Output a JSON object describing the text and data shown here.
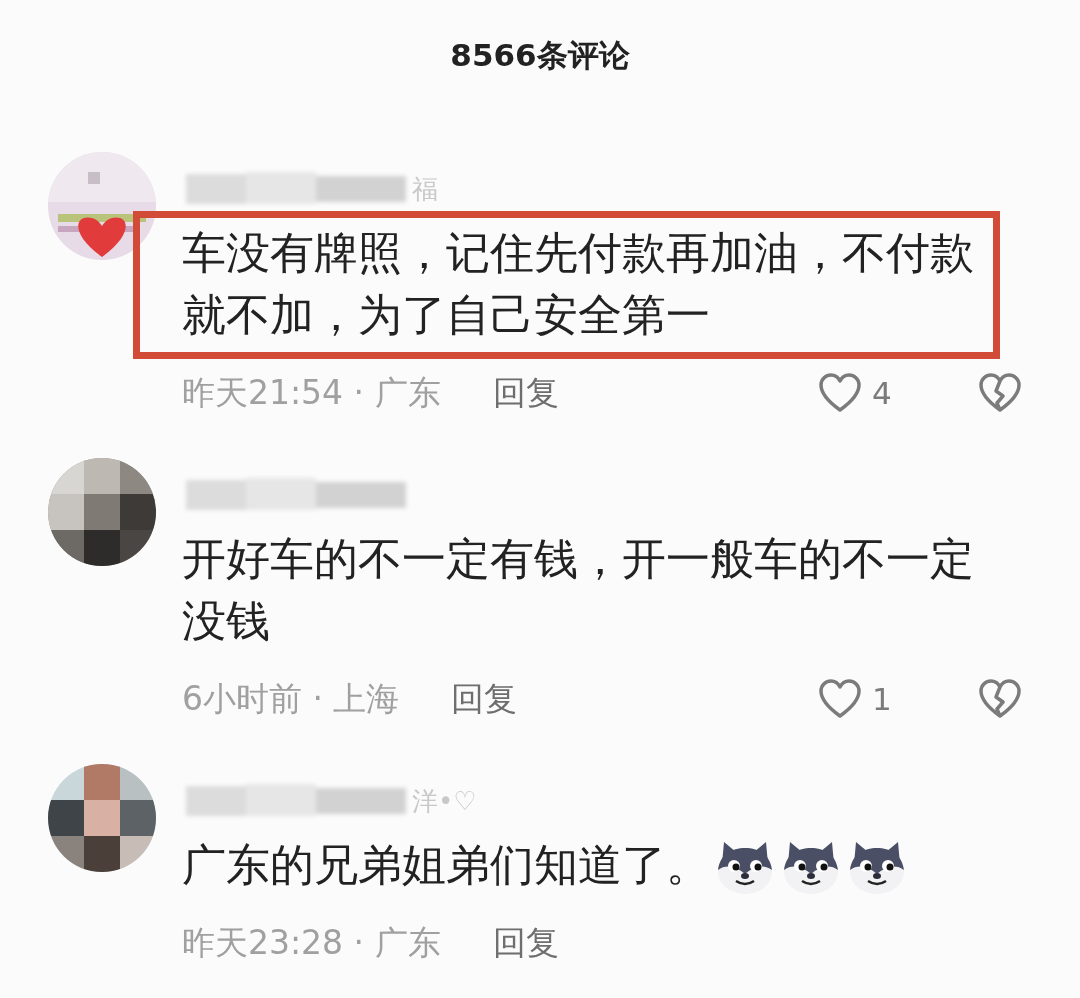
{
  "header": {
    "title": "8566条评论"
  },
  "comments": [
    {
      "name_tail": "福",
      "highlighted": true,
      "text": "车没有牌照，记住先付款再加油，不付款就不加，为了自己安全第一",
      "time_place": "昨天21:54 · 广东",
      "reply": "回复",
      "likes": "4",
      "dislike": true
    },
    {
      "highlighted": false,
      "text": "开好车的不一定有钱，开一般车的不一定没钱",
      "time_place": "6小时前 · 上海",
      "reply": "回复",
      "likes": "1",
      "dislike": true
    },
    {
      "name_tail": "洋•♡",
      "highlighted": false,
      "text": "广东的兄弟姐弟们知道了。",
      "emojis": [
        {
          "kind": "wolf"
        },
        {
          "kind": "wolf"
        },
        {
          "kind": "wolf"
        }
      ],
      "time_place": "昨天23:28 · 广东",
      "reply": "回复",
      "dislike": false
    }
  ]
}
